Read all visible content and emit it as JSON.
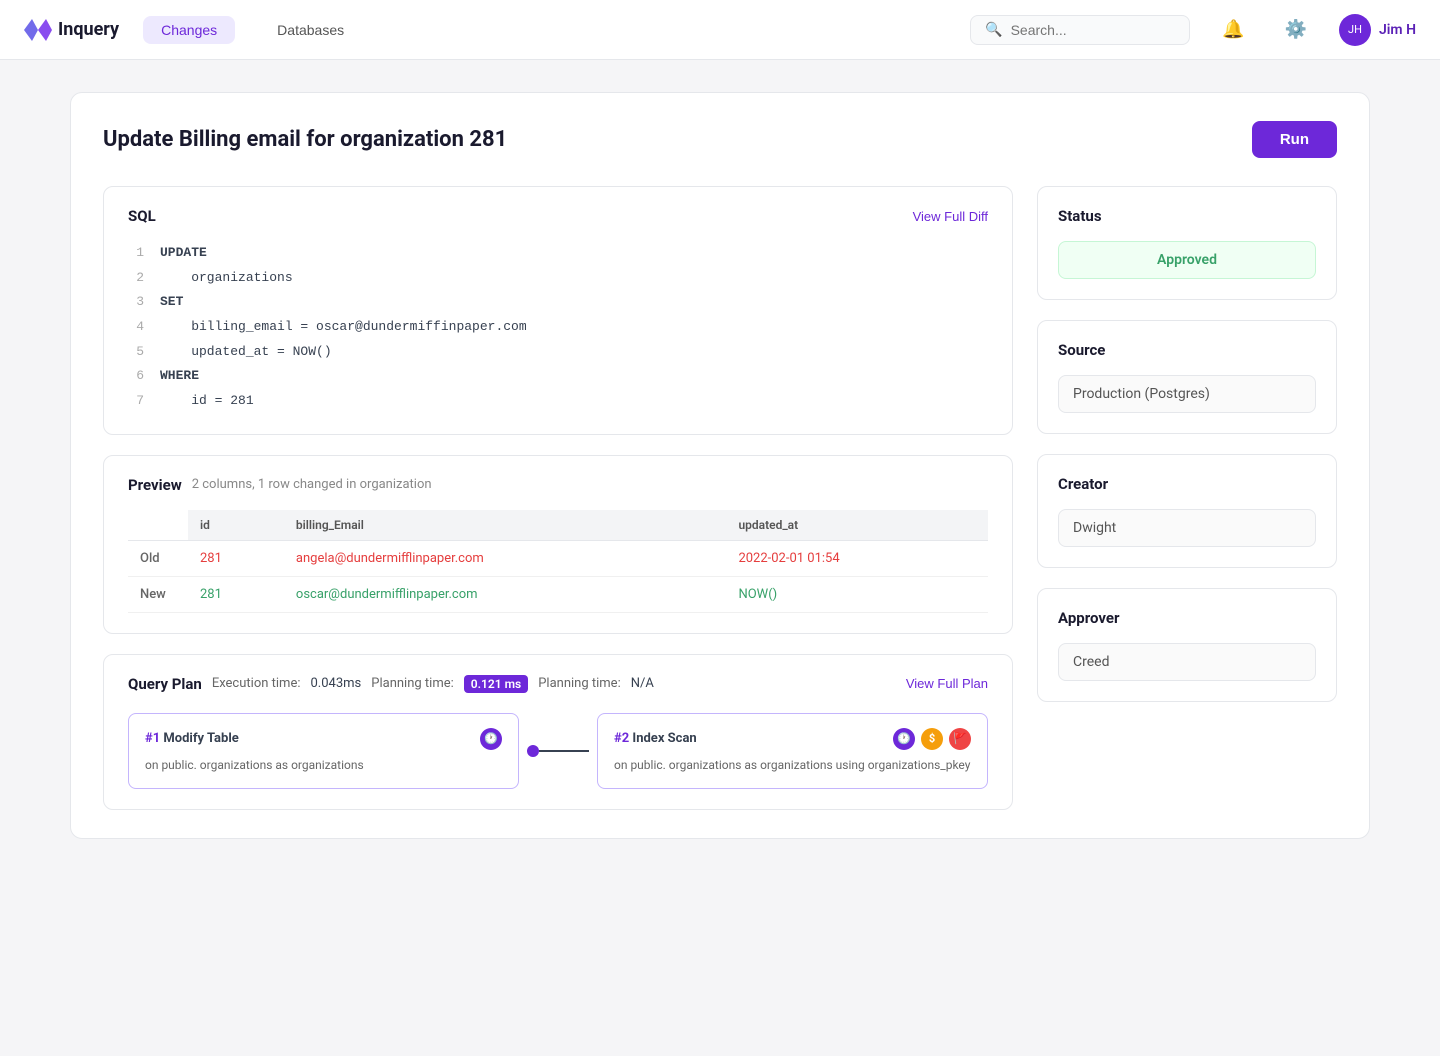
{
  "nav": {
    "logo_text": "Inquery",
    "changes_label": "Changes",
    "databases_label": "Databases",
    "search_placeholder": "Search...",
    "user_name": "Jim H"
  },
  "page": {
    "title": "Update Billing email for organization 281",
    "run_label": "Run"
  },
  "sql_section": {
    "title": "SQL",
    "view_diff_label": "View Full Diff",
    "lines": [
      {
        "num": "1",
        "code": "UPDATE"
      },
      {
        "num": "2",
        "code": "    organizations"
      },
      {
        "num": "3",
        "code": "SET"
      },
      {
        "num": "4",
        "code": "    billing_email = oscar@dundermiffinpaper.com"
      },
      {
        "num": "5",
        "code": "    updated_at = NOW()"
      },
      {
        "num": "6",
        "code": "WHERE"
      },
      {
        "num": "7",
        "code": "    id = 281"
      }
    ]
  },
  "preview_section": {
    "title": "Preview",
    "subtitle": "2 columns, 1 row changed in organization",
    "columns": [
      "id",
      "billing_Email",
      "updated_at"
    ],
    "old_row": {
      "label": "Old",
      "id": "281",
      "billing_email": "angela@dundermifflinpaper.com",
      "updated_at": "2022-02-01 01:54"
    },
    "new_row": {
      "label": "New",
      "id": "281",
      "billing_email": "oscar@dundermifflinpaper.com",
      "updated_at": "NOW()"
    }
  },
  "query_plan_section": {
    "title": "Query Plan",
    "execution_label": "Execution time:",
    "execution_val": "0.043ms",
    "planning1_label": "Planning time:",
    "planning1_val": "0.121 ms",
    "planning2_label": "Planning time:",
    "planning2_val": "N/A",
    "view_plan_label": "View Full Plan",
    "node1": {
      "num": "#1",
      "title": "Modify Table",
      "icon": "clock",
      "desc": "on public. organizations as organizations"
    },
    "node2": {
      "num": "#2",
      "title": "Index Scan",
      "icons": [
        "clock",
        "dollar",
        "flag"
      ],
      "desc": "on public. organizations as organizations using organizations_pkey"
    }
  },
  "status_section": {
    "title": "Status",
    "value": "Approved"
  },
  "source_section": {
    "title": "Source",
    "value": "Production (Postgres)"
  },
  "creator_section": {
    "title": "Creator",
    "value": "Dwight"
  },
  "approver_section": {
    "title": "Approver",
    "value": "Creed"
  }
}
